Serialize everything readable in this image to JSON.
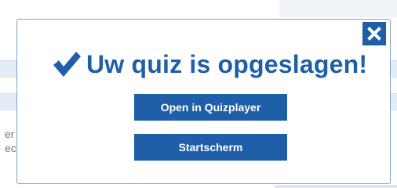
{
  "background": {
    "text_lines": [
      "er",
      "ec"
    ]
  },
  "modal": {
    "title": "Uw quiz is opgeslagen!",
    "icons": {
      "check": "checkmark-icon",
      "close": "close-icon"
    },
    "buttons": {
      "open_label": "Open in Quizplayer",
      "home_label": "Startscherm"
    }
  },
  "colors": {
    "accent": "#1f5faa",
    "modal_border": "#7fa2c6",
    "background_band": "#e4edf6"
  }
}
